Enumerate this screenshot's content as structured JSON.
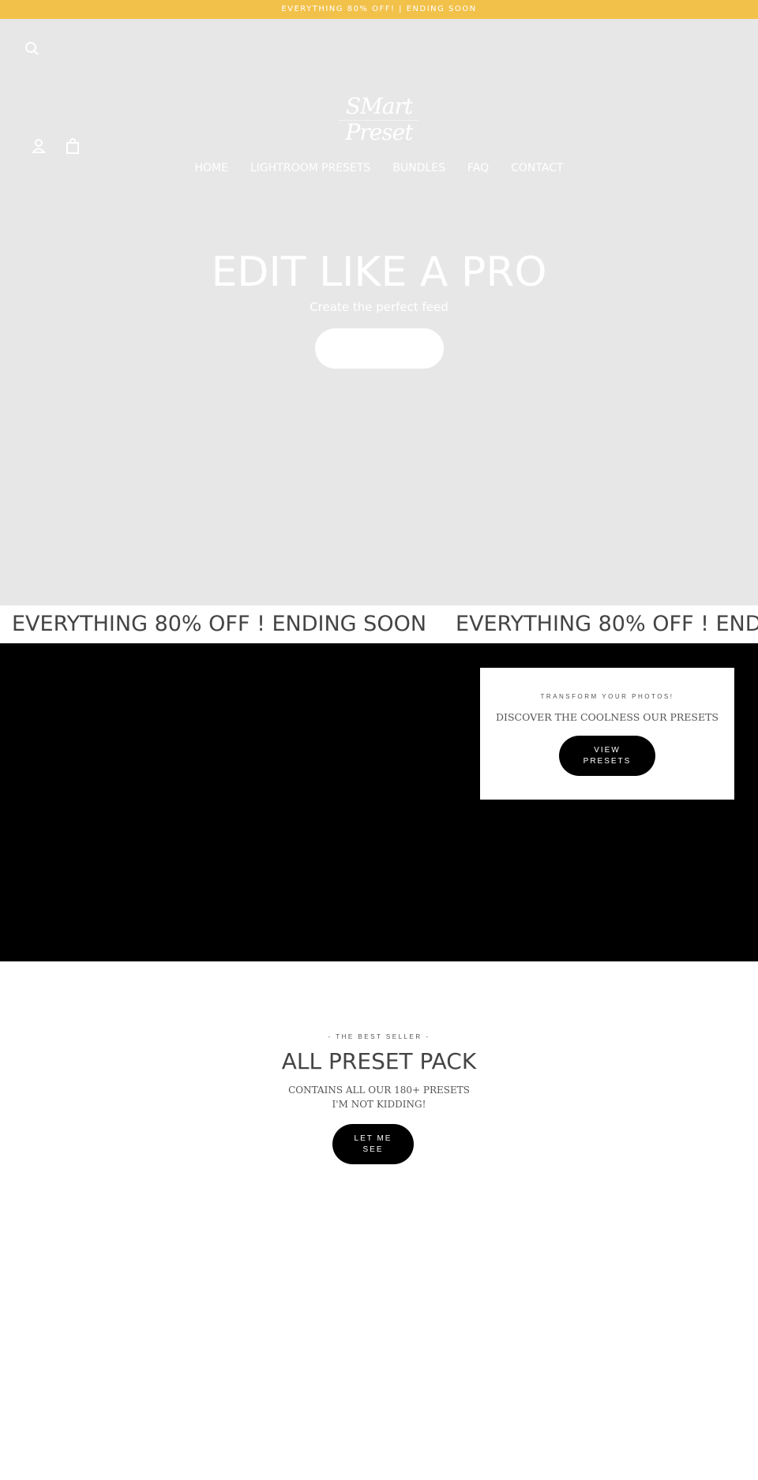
{
  "announcement": "EVERYTHING 80% OFF! | ENDING SOON",
  "header": {
    "logo": "SMart Preset",
    "icons": [
      "search-icon",
      "account-icon",
      "cart-icon"
    ]
  },
  "nav": [
    {
      "label": "HOME"
    },
    {
      "label": "LIGHTROOM PRESETS"
    },
    {
      "label": "BUNDLES"
    },
    {
      "label": "FAQ"
    },
    {
      "label": "CONTACT"
    }
  ],
  "hero": {
    "title": "EDIT LIKE A PRO",
    "subtitle": "Create the perfect feed",
    "button_label": ""
  },
  "marquee": [
    "EVERYTHING 80% OFF ! ENDING SOON",
    "EVERYTHING 80% OFF ! ENDING SOON"
  ],
  "feature_card": {
    "kicker": "TRANSFORM YOUR PHOTOS!",
    "heading": "DISCOVER THE COOLNESS OUR PRESETS",
    "button_line1": "VIEW",
    "button_line2": "PRESETS"
  },
  "best_seller": {
    "kicker": "- THE BEST SELLER -",
    "title": "ALL PRESET PACK",
    "line1": "CONTAINS ALL OUR 180+ PRESETS",
    "line2": "I'M NOT KIDDING!",
    "button_line1": "LET ME",
    "button_line2": "SEE"
  },
  "colors": {
    "announcement_bg": "#f2c14a",
    "hero_bg": "#e7e7e7",
    "dark": "#000000",
    "text": "#444444"
  }
}
